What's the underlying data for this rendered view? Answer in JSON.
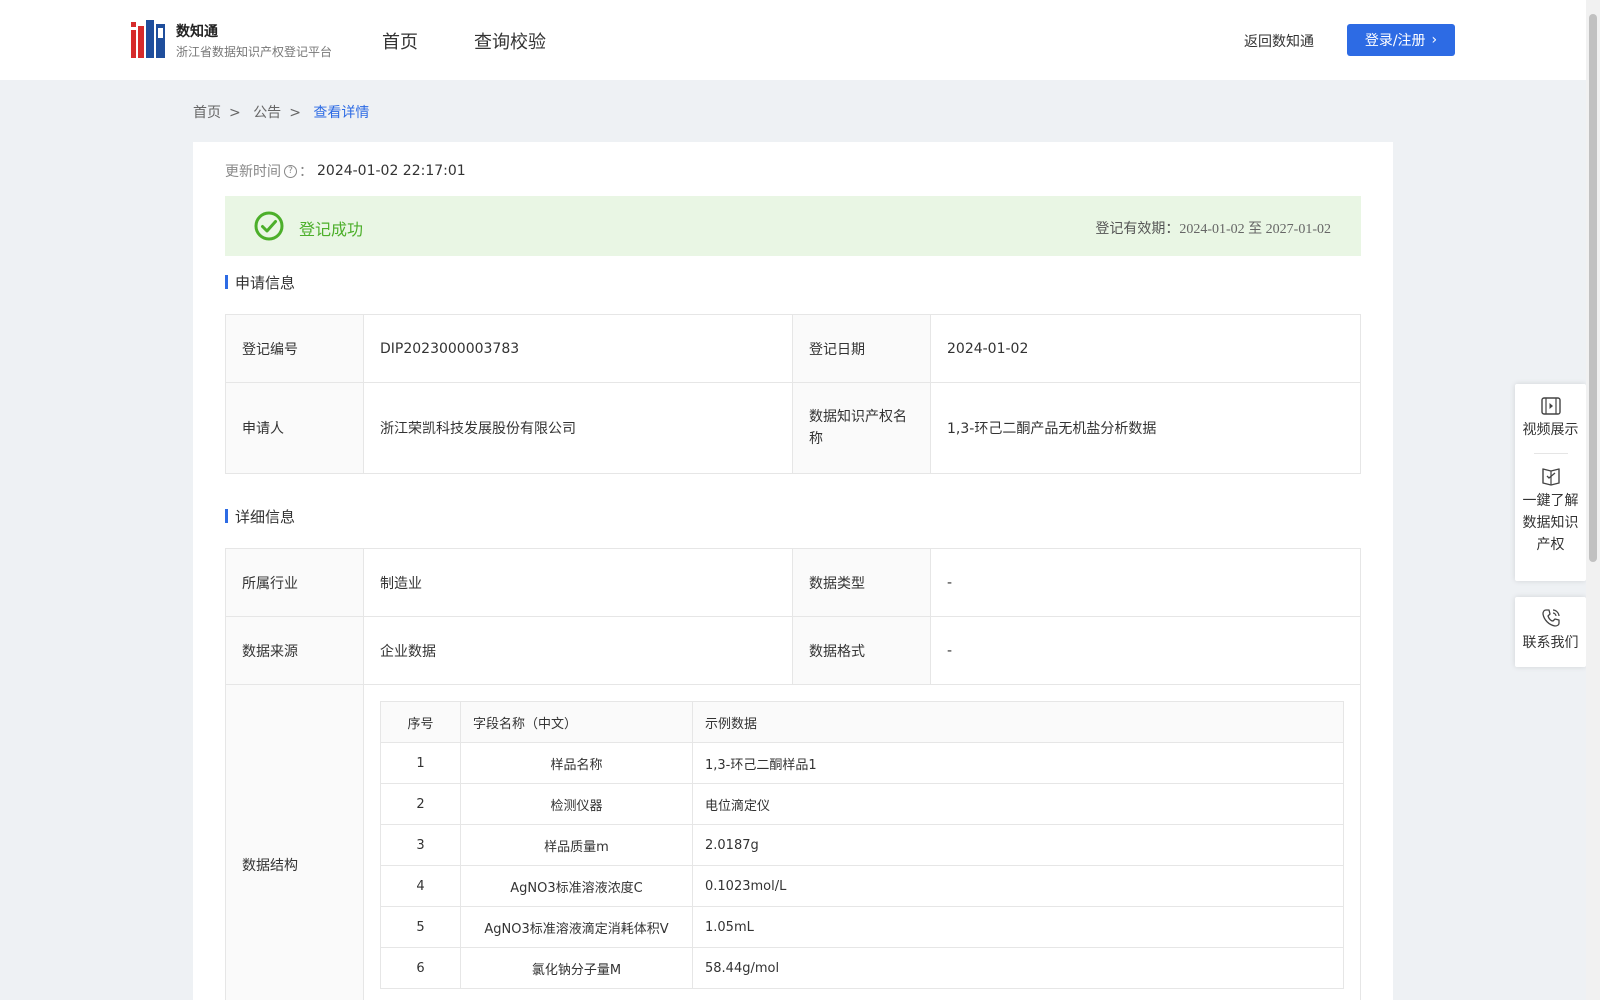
{
  "header": {
    "brand_title": "数知通",
    "brand_subtitle": "浙江省数据知识产权登记平台",
    "nav": [
      "首页",
      "查询校验"
    ],
    "back_link": "返回数知通",
    "login_button": "登录/注册"
  },
  "breadcrumb": [
    "首页",
    "公告",
    "查看详情"
  ],
  "update": {
    "label": "更新时间",
    "value": "2024-01-02 22:17:01"
  },
  "status": {
    "text": "登记成功",
    "validity_label": "登记有效期：",
    "validity_value": "2024-01-02 至 2027-01-02",
    "color": "#4caf2a"
  },
  "application": {
    "title": "申请信息",
    "rows": [
      {
        "l1": "登记编号",
        "v1": "DIP2023000003783",
        "l2": "登记日期",
        "v2": "2024-01-02"
      },
      {
        "l1": "申请人",
        "v1": "浙江荣凯科技发展股份有限公司",
        "l2": "数据知识产权名称",
        "v2": "1,3-环己二酮产品无机盐分析数据"
      }
    ]
  },
  "detail": {
    "title": "详细信息",
    "rows": [
      {
        "l1": "所属行业",
        "v1": "制造业",
        "l2": "数据类型",
        "v2": "-"
      },
      {
        "l1": "数据来源",
        "v1": "企业数据",
        "l2": "数据格式",
        "v2": "-"
      }
    ],
    "structure_label": "数据结构",
    "structure_headers": [
      "序号",
      "字段名称（中文）",
      "示例数据"
    ],
    "structure_rows": [
      [
        "1",
        "样品名称",
        "1,3-环己二酮样品1"
      ],
      [
        "2",
        "检测仪器",
        "电位滴定仪"
      ],
      [
        "3",
        "样品质量m",
        "2.0187g"
      ],
      [
        "4",
        "AgNO3标准溶液浓度C",
        "0.1023mol/L"
      ],
      [
        "5",
        "AgNO3标准溶液滴定消耗体积V",
        "1.05mL"
      ],
      [
        "6",
        "氯化钠分子量M",
        "58.44g/mol"
      ]
    ]
  },
  "side_panel": {
    "video": "视频展示",
    "learn": [
      "一鍵了解",
      "数据知识",
      "产权"
    ],
    "contact": "联系我们"
  },
  "colors": {
    "accent": "#2d6be4",
    "success_bg": "#e9f6e4"
  }
}
